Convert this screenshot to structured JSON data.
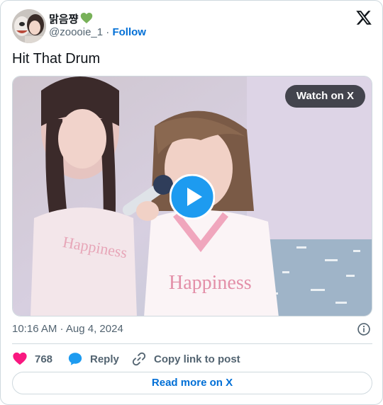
{
  "author": {
    "display_name": "맑음쨩",
    "handle": "@zoooie_1",
    "separator": "·",
    "follow_label": "Follow",
    "name_emoji": "green-heart-icon"
  },
  "tweet": {
    "text": "Hit That Drum"
  },
  "media": {
    "watch_label": "Watch on X",
    "play_icon": "play-icon"
  },
  "meta": {
    "timestamp": "10:16 AM · Aug 4, 2024"
  },
  "actions": {
    "like_count": "768",
    "reply_label": "Reply",
    "copy_label": "Copy link to post"
  },
  "footer": {
    "read_more_label": "Read more on X"
  },
  "colors": {
    "accent": "#006fd6",
    "like": "#f91880",
    "reply": "#1d9bf0",
    "muted": "#536471",
    "border": "#cfd9de"
  }
}
